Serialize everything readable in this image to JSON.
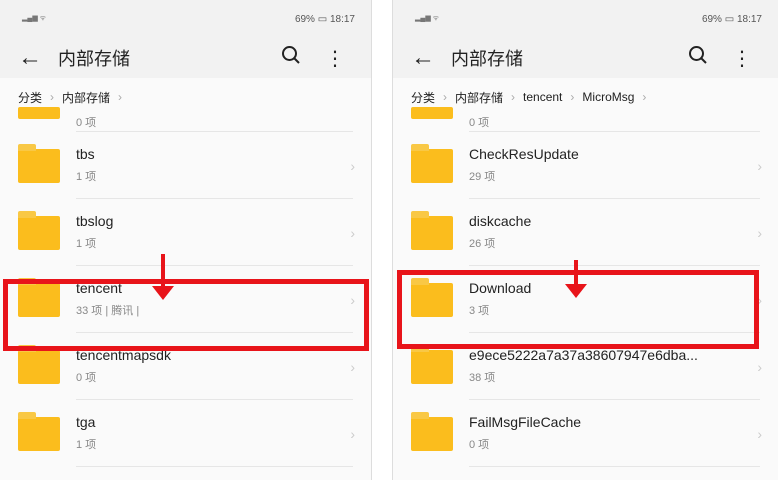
{
  "status": {
    "time": "18:17",
    "battery": "69%"
  },
  "header": {
    "title": "内部存储"
  },
  "left": {
    "breadcrumb": [
      "分类",
      "内部存储"
    ],
    "items": [
      {
        "name": "",
        "count": "0 项"
      },
      {
        "name": "tbs",
        "count": "1 项"
      },
      {
        "name": "tbslog",
        "count": "1 项"
      },
      {
        "name": "tencent",
        "count": "33 项 | 腾讯 |"
      },
      {
        "name": "tencentmapsdk",
        "count": "0 项"
      },
      {
        "name": "tga",
        "count": "1 项"
      }
    ]
  },
  "right": {
    "breadcrumb": [
      "分类",
      "内部存储",
      "tencent",
      "MicroMsg"
    ],
    "items": [
      {
        "name": "",
        "count": "0 项"
      },
      {
        "name": "CheckResUpdate",
        "count": "29 项"
      },
      {
        "name": "diskcache",
        "count": "26 项"
      },
      {
        "name": "Download",
        "count": "3 项"
      },
      {
        "name": "e9ece5222a7a37a38607947e6dba...",
        "count": "38 项"
      },
      {
        "name": "FailMsgFileCache",
        "count": "0 项"
      }
    ]
  },
  "colors": {
    "highlight": "#e8141a",
    "folder": "#fbbd1d"
  }
}
